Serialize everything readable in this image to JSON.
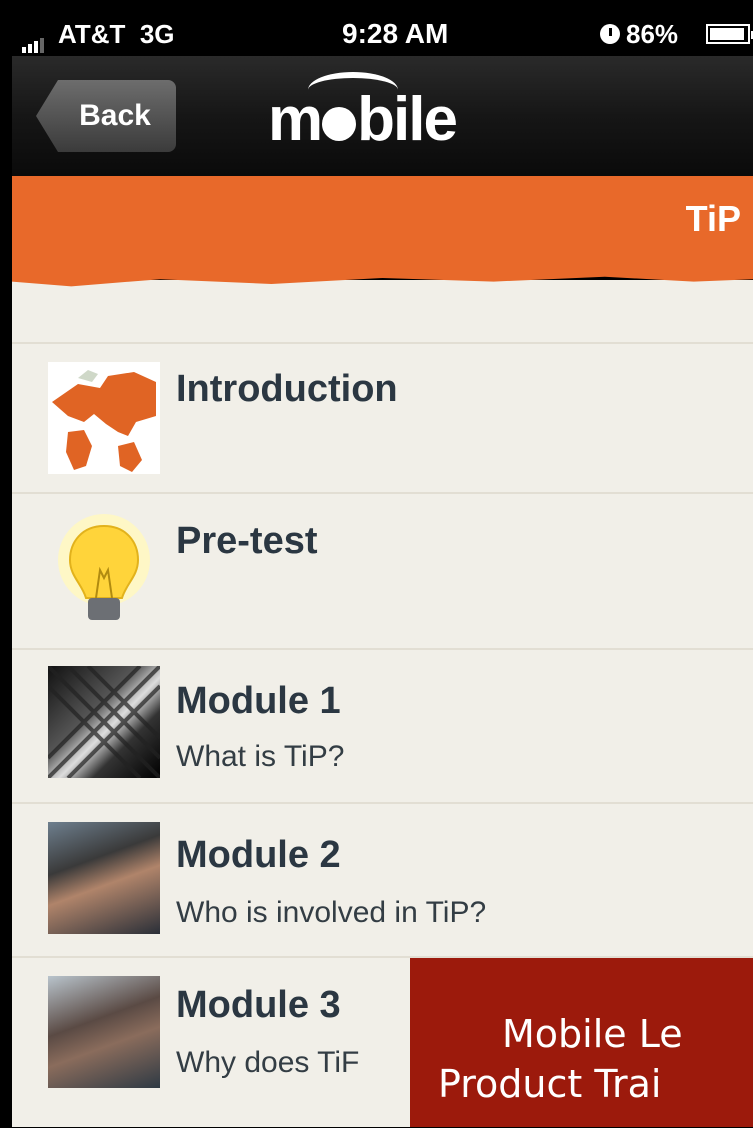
{
  "status_bar": {
    "carrier": "AT&T",
    "network": "3G",
    "time": "9:28 AM",
    "battery": "86%",
    "icons": [
      "signal-icon",
      "clock-icon",
      "battery-icon"
    ]
  },
  "nav": {
    "back_label": "Back",
    "logo_text": "mobile"
  },
  "header": {
    "title": "TiP",
    "accent_color": "#e8692a"
  },
  "items": [
    {
      "title": "Introduction",
      "subtitle": "",
      "thumb": "world-map-thumbnail"
    },
    {
      "title": "Pre-test",
      "subtitle": "",
      "thumb": "light-bulb-thumbnail"
    },
    {
      "title": "Module 1",
      "subtitle": "What is TiP?",
      "thumb": "module-1-photo"
    },
    {
      "title": "Module 2",
      "subtitle": "Who is involved in TiP?",
      "thumb": "module-2-photo"
    },
    {
      "title": "Module 3",
      "subtitle": "Why does TiF",
      "thumb": "module-3-photo"
    }
  ],
  "overlay": {
    "line1": "Mobile Le",
    "line2": "Product Trai",
    "color": "#9c1a0c"
  }
}
